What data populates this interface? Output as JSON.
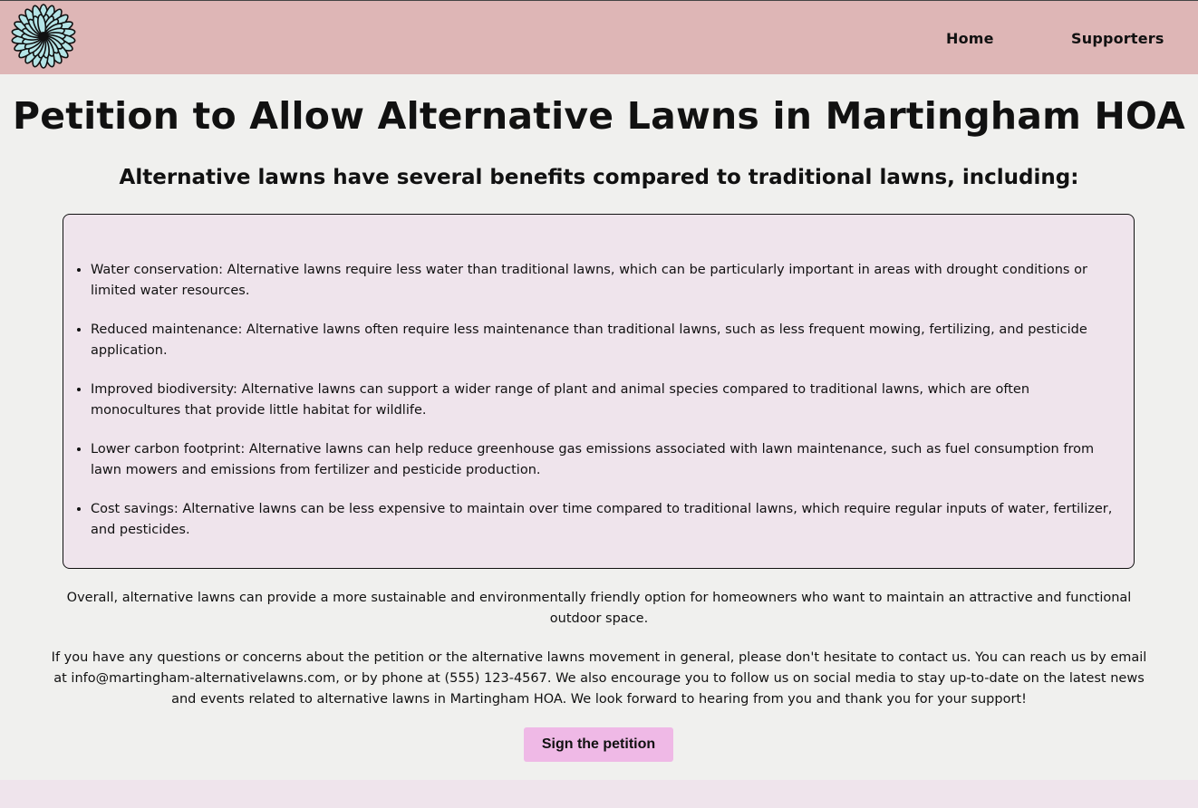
{
  "nav": {
    "logo_icon": "daisy-flower-icon",
    "links": [
      {
        "label": "Home"
      },
      {
        "label": "Supporters"
      }
    ]
  },
  "main": {
    "title": "Petition to Allow Alternative Lawns in Martingham HOA",
    "subtitle": "Alternative lawns have several benefits compared to traditional lawns, including:",
    "benefits": [
      "Water conservation: Alternative lawns require less water than traditional lawns, which can be particularly important in areas with drought conditions or limited water resources.",
      "Reduced maintenance: Alternative lawns often require less maintenance than traditional lawns, such as less frequent mowing, fertilizing, and pesticide application.",
      "Improved biodiversity: Alternative lawns can support a wider range of plant and animal species compared to traditional lawns, which are often monocultures that provide little habitat for wildlife.",
      "Lower carbon footprint: Alternative lawns can help reduce greenhouse gas emissions associated with lawn maintenance, such as fuel consumption from lawn mowers and emissions from fertilizer and pesticide production.",
      "Cost savings: Alternative lawns can be less expensive to maintain over time compared to traditional lawns, which require regular inputs of water, fertilizer, and pesticides."
    ],
    "summary": "Overall, alternative lawns can provide a more sustainable and environmentally friendly option for homeowners who want to maintain an attractive and functional outdoor space.",
    "contact": "If you have any questions or concerns about the petition or the alternative lawns movement in general, please don't hesitate to contact us. You can reach us by email at info@martingham-alternativelawns.com, or by phone at (555) 123-4567. We also encourage you to follow us on social media to stay up-to-date on the latest news and events related to alternative lawns in Martingham HOA. We look forward to hearing from you and thank you for your support!",
    "sign_button": "Sign the petition"
  },
  "colors": {
    "navbar": "#deb6b6",
    "page_bg": "#f0f0ee",
    "box_bg": "#efe4ec",
    "button_bg": "#efb9e6",
    "logo_petals": "#b4e4e6"
  }
}
